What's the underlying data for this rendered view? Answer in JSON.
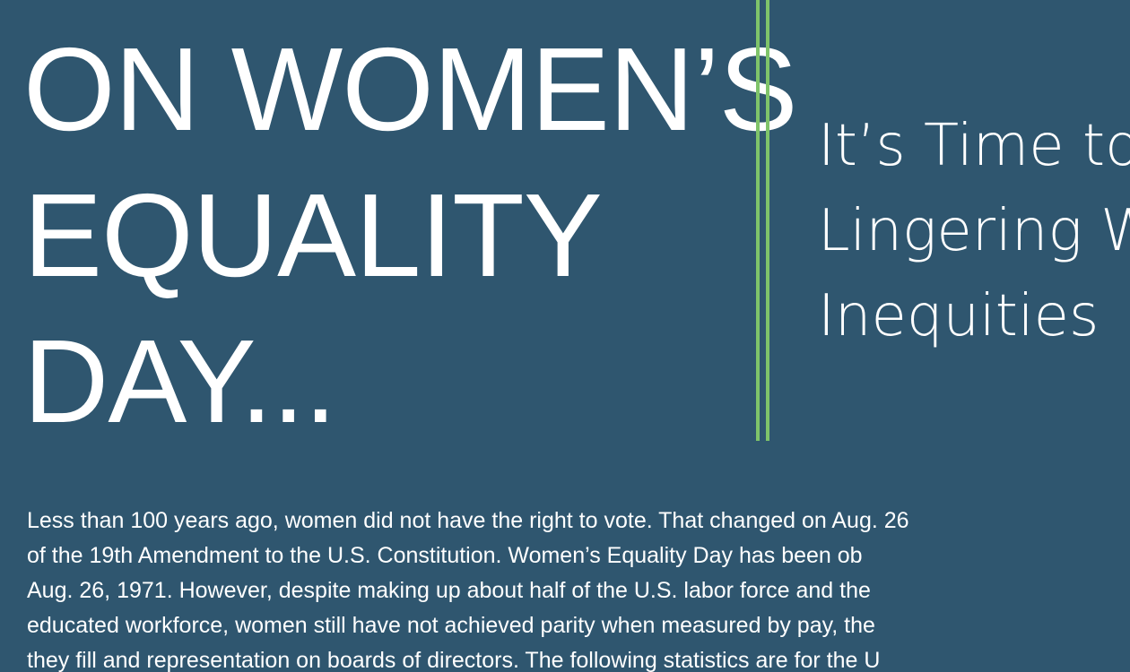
{
  "headline": {
    "line1": "ON WOMEN’S",
    "line2": "EQUALITY",
    "line3": "DAY..."
  },
  "subhead": {
    "line1": "It’s Time to",
    "line2": "Lingering W",
    "line3": "Inequities"
  },
  "body": {
    "lines": [
      "Less than 100 years ago, women did not have the right to vote. That changed on Aug. 26",
      "of the 19th Amendment to the U.S. Constitution. Women’s Equality Day has been ob",
      "Aug. 26, 1971. However, despite making up about half of the U.S. labor force and the",
      "educated workforce, women still have not achieved parity when measured by pay, the",
      "they fill and representation on boards of directors. The following statistics are for the U"
    ]
  },
  "colors": {
    "background": "#2f566f",
    "accent": "#7fc46a",
    "text": "#ffffff"
  }
}
